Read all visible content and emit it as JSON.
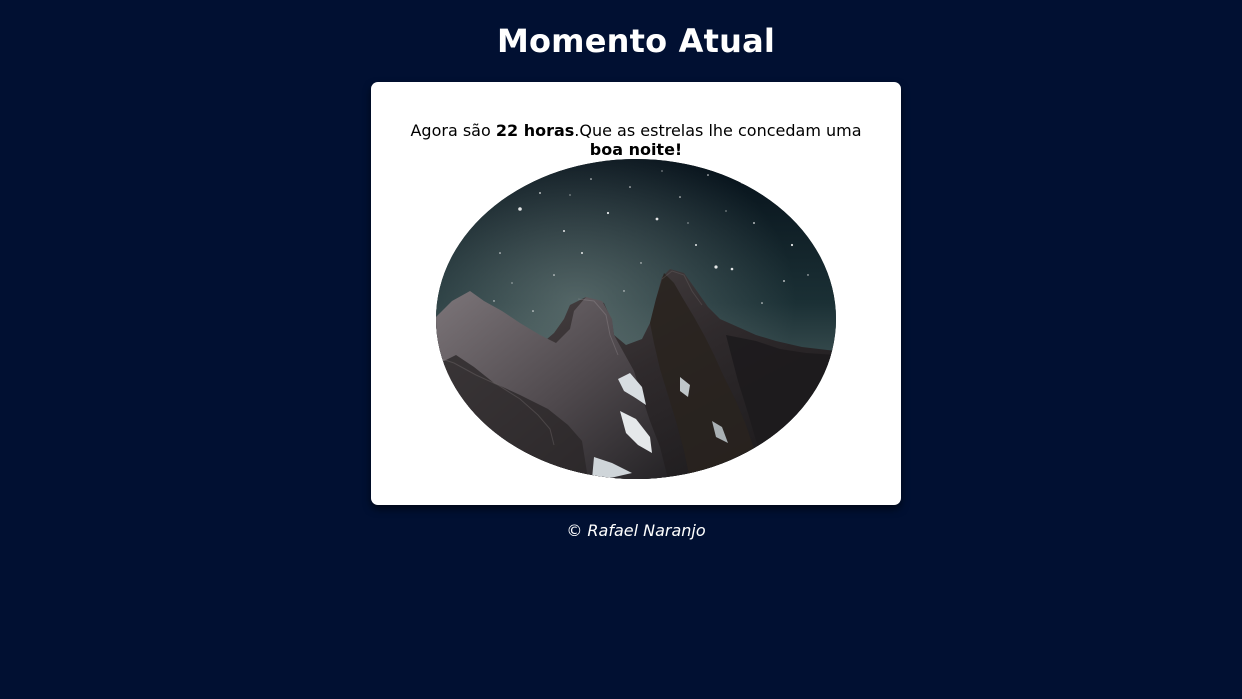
{
  "header": {
    "title": "Momento Atual"
  },
  "card": {
    "message_prefix": "Agora são ",
    "hour_text": "22 horas",
    "message_middle": ".Que as estrelas lhe concedam uma ",
    "greeting": "boa noite!"
  },
  "image": {
    "scene": "night-mountain-starry-sky"
  },
  "footer": {
    "copyright": "© Rafael Naranjo"
  },
  "colors": {
    "page_background": "#011032",
    "card_background": "#ffffff",
    "title_text": "#ffffff",
    "message_text": "#000000"
  }
}
